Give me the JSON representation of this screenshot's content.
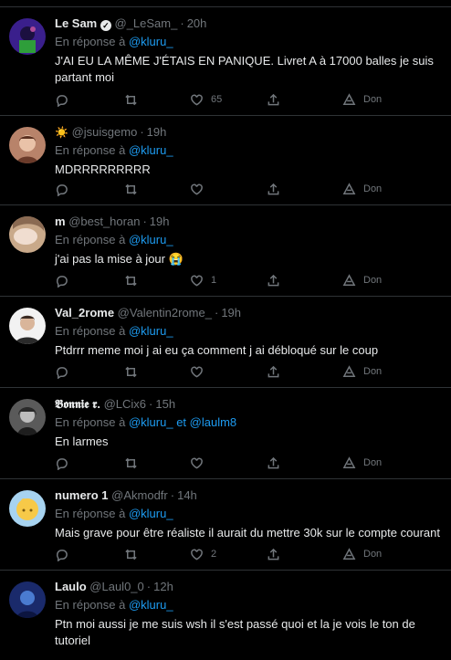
{
  "reply_prefix": "En réponse à",
  "actions": {
    "donate_label": "Don"
  },
  "tweets": [
    {
      "name": "Le Sam",
      "handle": "@_LeSam_",
      "time": "20h",
      "reply_to": "@kluru_",
      "text": "J'AI EU LA MÊME J'ÉTAIS EN PANIQUE. Livret A à 17000 balles je suis partant moi",
      "like_count": "65",
      "avatar": {
        "color": "#3a1f8c",
        "accent": "#2e9e3a"
      }
    },
    {
      "name_emoji": "☀️",
      "name": "",
      "handle": "@jsuisgemo",
      "time": "19h",
      "reply_to": "@kluru_",
      "text": "MDRRRRRRRRR",
      "avatar": {
        "color": "#b8836a",
        "accent": "#e9c2a8"
      }
    },
    {
      "name": "m",
      "handle": "@best_horan",
      "time": "19h",
      "reply_to": "@kluru_",
      "text": "j'ai pas la mise à jour 😭",
      "like_count": "1",
      "avatar": {
        "color": "#c9a98a",
        "accent": "#f0ddd0"
      }
    },
    {
      "name": "Val_2rome",
      "handle": "@Valentin2rome_",
      "time": "19h",
      "reply_to": "@kluru_",
      "text": "Ptdrrr meme moi j ai eu ça comment j ai débloqué sur le coup",
      "avatar": {
        "color": "#f2f2f2",
        "accent": "#3a2a22"
      }
    },
    {
      "name": "𝕭𝖔𝖓𝖓𝖎𝖊 𝖗.",
      "handle": "@LCix6",
      "time": "15h",
      "reply_to": "@kluru_",
      "reply_join": "et",
      "reply_to_2": "@laulm8",
      "text": "En larmes",
      "avatar": {
        "color": "#5a5a5a",
        "accent": "#bdbdbd"
      }
    },
    {
      "name": "numero 1",
      "handle": "@Akmodfr",
      "time": "14h",
      "reply_to": "@kluru_",
      "text": "Mais grave pour être réaliste il aurait du mettre 30k sur le compte courant",
      "like_count": "2",
      "avatar": {
        "color": "#a7d3f0",
        "accent": "#f7c948"
      }
    },
    {
      "name": "Laulo",
      "handle": "@Laul0_0",
      "time": "12h",
      "reply_to": "@kluru_",
      "text": "Ptn moi aussi je me suis wsh il s'est passé quoi et la je vois le ton de tutoriel",
      "avatar": {
        "color": "#1a2a6b",
        "accent": "#4a7bd0"
      }
    }
  ]
}
